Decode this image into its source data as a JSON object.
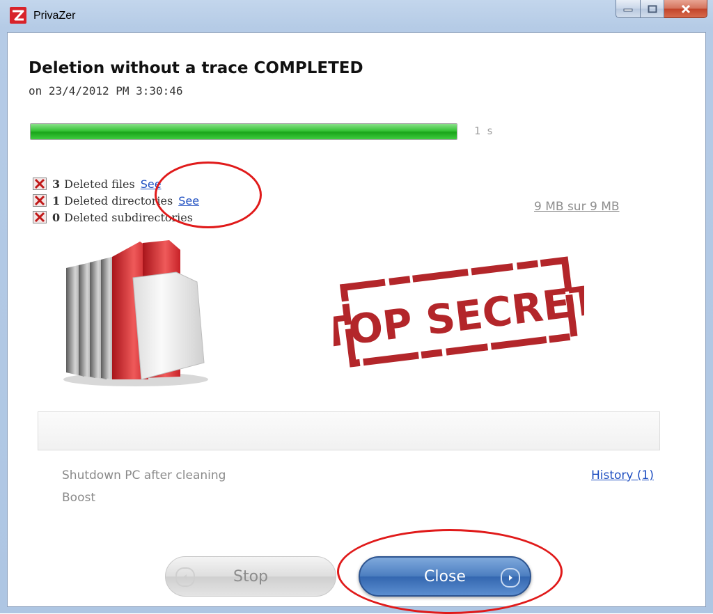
{
  "window": {
    "title": "PrivaZer"
  },
  "header": {
    "headline": "Deletion without a trace COMPLETED",
    "subline": "on 23/4/2012 PM 3:30:46"
  },
  "progress": {
    "percent": 100,
    "duration": "1 s"
  },
  "stats": [
    {
      "count": "3",
      "label": "Deleted files",
      "link": "See"
    },
    {
      "count": "1",
      "label": "Deleted directories",
      "link": "See"
    },
    {
      "count": "0",
      "label": "Deleted subdirectories",
      "link": ""
    }
  ],
  "size_text": "9 MB sur 9 MB",
  "stamp_text": "TOP SECRET",
  "options": {
    "shutdown": "Shutdown PC after cleaning",
    "boost": "Boost",
    "history": "History (1)"
  },
  "buttons": {
    "stop": "Stop",
    "close": "Close"
  },
  "colors": {
    "progress_green": "#36c336",
    "link_blue": "#1f4fc1",
    "close_button_blue": "#4d7fc1",
    "annotation_red": "#e01a1a",
    "stamp_red": "#b3262a"
  }
}
